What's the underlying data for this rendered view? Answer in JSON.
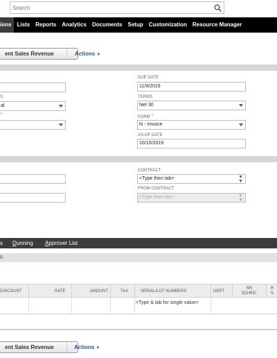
{
  "search": {
    "placeholder": "Search"
  },
  "nav": {
    "items": [
      {
        "label": "ions",
        "active": true
      },
      {
        "label": "Lists"
      },
      {
        "label": "Reports"
      },
      {
        "label": "Analytics"
      },
      {
        "label": "Documents"
      },
      {
        "label": "Setup"
      },
      {
        "label": "Customization"
      },
      {
        "label": "Resource Manager"
      }
    ]
  },
  "toolbar": {
    "primary_label": "ent Sales Revenue",
    "actions_label": "Actions"
  },
  "primary": {
    "left_label_1": "S",
    "left_select_1": "al",
    "left_required_mark": "*",
    "due_date_label": "DUE DATE",
    "due_date_value": "11/9/2019",
    "terms_label": "TERMS",
    "terms_value": "Net 30",
    "form_label": "FORM",
    "form_required_mark": "*",
    "form_value": "N - Invoice",
    "as_of_date_label": "AS-OF DATE",
    "as_of_date_value": "10/10/2019"
  },
  "classification": {
    "contract_label": "CONTRACT",
    "contract_value": "<Type then tab>",
    "from_contract_label": "FROM CONTRACT",
    "from_contract_value": "<Type then tab>"
  },
  "subtabs": {
    "items": [
      {
        "label": "s"
      },
      {
        "label": "Dunning",
        "accel": "D"
      },
      {
        "label": "Approver List",
        "accel": "A"
      }
    ],
    "subbar_text": "0"
  },
  "items_grid": {
    "columns": [
      "DISCOUNT",
      "RATE",
      "AMOUNT",
      "TAX",
      "SERIAL/LOT NUMBERS",
      "DEPT",
      "RR SCHED.",
      "R S"
    ],
    "serial_placeholder": "<Type & tab for single value>"
  },
  "bottom_toolbar": {
    "primary_label": "ent Sales Revenue",
    "actions_label": "Actions"
  },
  "colors": {
    "nav_bg": "#000000",
    "link_blue": "#255599",
    "required_mark": "#e8a300",
    "select_arrow": "#2f5fa8"
  }
}
